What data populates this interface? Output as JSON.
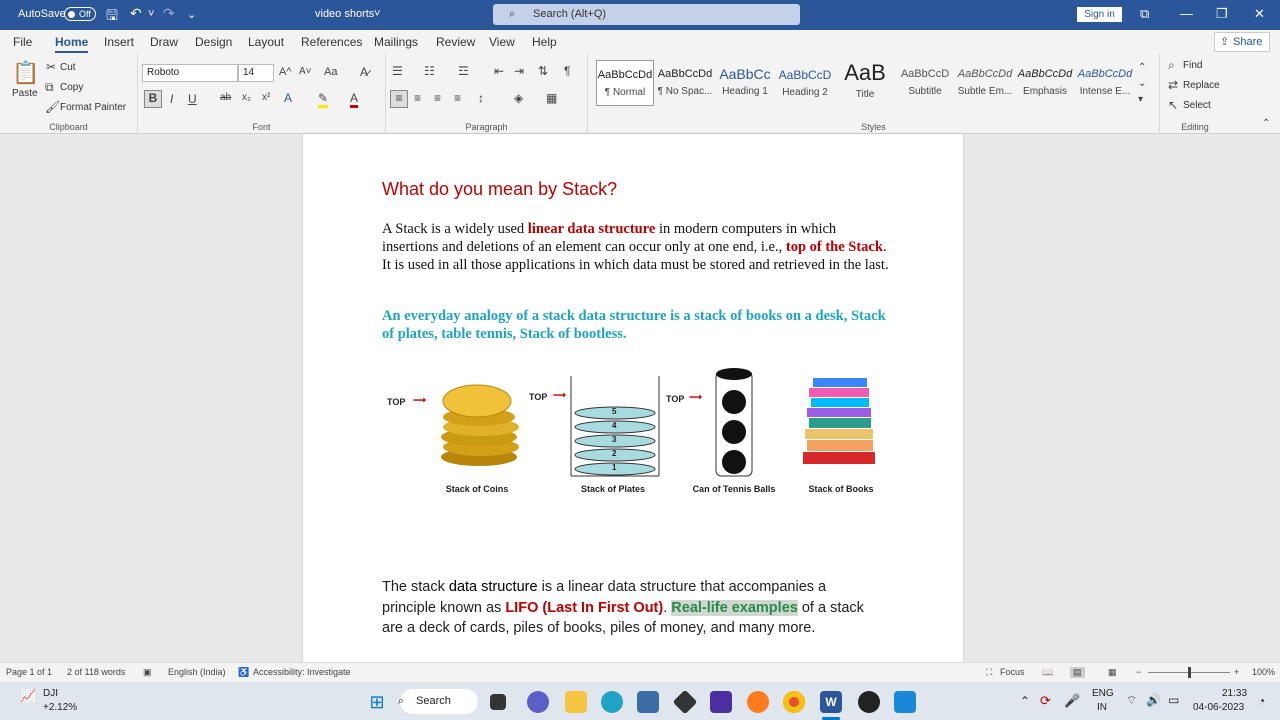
{
  "titlebar": {
    "autosave_label": "AutoSave",
    "autosave_state": "Off",
    "doc_name": "video shorts",
    "search_placeholder": "Search (Alt+Q)",
    "signin": "Sign in",
    "bg": "#2b579a"
  },
  "tabs": [
    "File",
    "Home",
    "Insert",
    "Draw",
    "Design",
    "Layout",
    "References",
    "Mailings",
    "Review",
    "View",
    "Help"
  ],
  "share": "Share",
  "ribbon": {
    "clipboard": {
      "paste": "Paste",
      "cut": "Cut",
      "copy": "Copy",
      "format_painter": "Format Painter",
      "label": "Clipboard"
    },
    "font": {
      "name": "Roboto",
      "size": "14",
      "label": "Font",
      "grow": "A^",
      "shrink": "A˅",
      "case": "Aa"
    },
    "paragraph": {
      "label": "Paragraph"
    },
    "styles": {
      "label": "Styles",
      "items": [
        {
          "sample": "AaBbCcDd",
          "name": "¶ Normal"
        },
        {
          "sample": "AaBbCcDd",
          "name": "¶ No Spac..."
        },
        {
          "sample": "AaBbCc",
          "name": "Heading 1"
        },
        {
          "sample": "AaBbCcD",
          "name": "Heading 2"
        },
        {
          "sample": "AaB",
          "name": "Title"
        },
        {
          "sample": "AaBbCcD",
          "name": "Subtitle"
        },
        {
          "sample": "AaBbCcDd",
          "name": "Subtle Em..."
        },
        {
          "sample": "AaBbCcDd",
          "name": "Emphasis"
        },
        {
          "sample": "AaBbCcDd",
          "name": "Intense E..."
        }
      ]
    },
    "editing": {
      "find": "Find",
      "replace": "Replace",
      "select": "Select",
      "label": "Editing"
    }
  },
  "document": {
    "heading": "What do you mean by Stack?",
    "p1_a": "A Stack is a widely used ",
    "p1_b": "linear data structure",
    "p1_c": " in modern computers in which insertions and deletions of an element can occur only at one end, i.e., ",
    "p1_d": "top of the Stack",
    "p1_e": ". It is used in all those applications in which data must be stored and retrieved in the last.",
    "p2": "An everyday analogy of a stack data structure is a stack of books on a desk, Stack of plates, table tennis, Stack of bootless.",
    "illustration": {
      "top_label": "TOP",
      "captions": [
        "Stack of Coins",
        "Stack of Plates",
        "Can of Tennis Balls",
        "Stack of Books"
      ],
      "plate_numbers": [
        "5",
        "4",
        "3",
        "2",
        "1"
      ]
    },
    "p3_a": "The stack ",
    "p3_b": "data structure",
    "p3_c": " is a linear data structure that accompanies a principle known as  ",
    "p3_d": "LIFO (Last In First Out)",
    "p3_e": ". ",
    "p3_f": "Real-life examples",
    "p3_g": " of a stack are a deck of cards, piles of books, piles of money, and many more."
  },
  "status": {
    "page": "Page 1 of 1",
    "words": "2 of 118 words",
    "language": "English (India)",
    "accessibility": "Accessibility: Investigate",
    "focus": "Focus",
    "zoom": "100%",
    "zoom_level": 0.5
  },
  "taskbar": {
    "weather_name": "DJI",
    "weather_change": "+2.12%",
    "search": "Search",
    "lang1": "ENG",
    "lang2": "IN",
    "time": "21:33",
    "date": "04-06-2023"
  }
}
